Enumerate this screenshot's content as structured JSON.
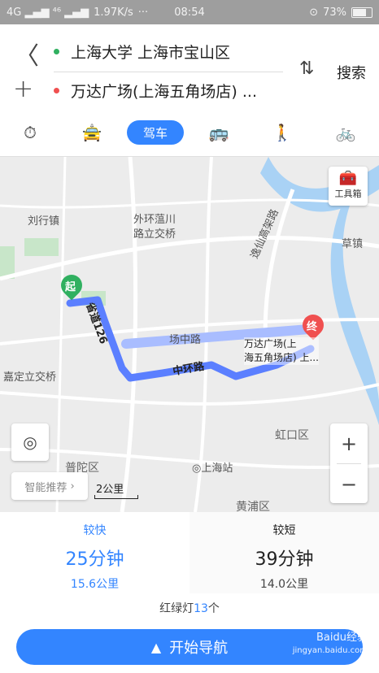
{
  "status_bar": {
    "signal_text": "4G ▂▄▆ ⁴⁶ ▂▄▆",
    "speed": "1.97K/s",
    "dots": "···",
    "time": "08:54",
    "battery": "73%"
  },
  "route": {
    "from": "上海大学 上海市宝山区",
    "to": "万达广场(上海五角场店) ...",
    "search_label": "搜索"
  },
  "modes": {
    "active_label": "驾车",
    "icons": [
      "timer-icon",
      "taxi-icon",
      "car-icon",
      "bus-icon",
      "walk-icon",
      "bike-icon"
    ]
  },
  "map": {
    "toolbox_label": "工具箱",
    "labels": {
      "liuxing": "刘行镇",
      "waihuan": "外环蕰川",
      "waihuan2": "路立交桥",
      "caojing": "草镇",
      "yixian": "逸仙高架路",
      "changzhong": "场中路",
      "shengdao": "省道126",
      "zhonghuan": "中环路",
      "jiading": "嘉定立交桥",
      "hongkou": "虹口区",
      "putuo": "普陀区",
      "shanghaizhan": "上海站",
      "huangpu": "黄浦区",
      "dest": "万达广场(上",
      "dest2": "海五角场店) 上..."
    },
    "start_pin": "起",
    "end_pin": "终",
    "recommend": "智能推荐",
    "scale": "2公里",
    "colors": {
      "route_main": "#5b7fff",
      "route_alt": "#a9bdff"
    }
  },
  "options": [
    {
      "tag": "较快",
      "time": "25分钟",
      "dist": "15.6公里"
    },
    {
      "tag": "较短",
      "time": "39分钟",
      "dist": "14.0公里"
    }
  ],
  "lights": {
    "label_pre": "红绿灯",
    "count": "13",
    "label_post": "个"
  },
  "nav_button": "开始导航",
  "watermark": {
    "line1": "Baidu经验",
    "line2": "jingyan.baidu.com"
  }
}
